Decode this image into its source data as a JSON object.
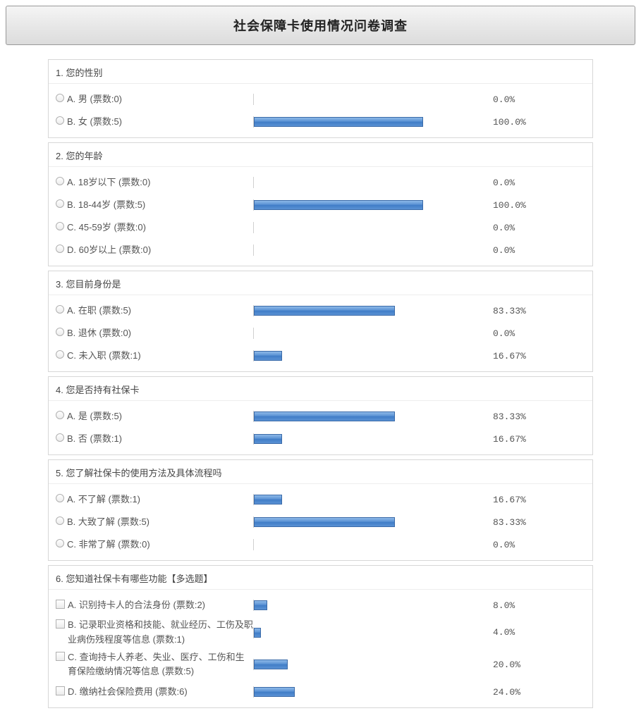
{
  "title": "社会保障卡使用情况问卷调查",
  "chart_data": {
    "type": "bar",
    "questions": [
      {
        "title": "1. 您的性别",
        "kind": "radio",
        "options": [
          {
            "label": "A. 男 (票数:0)",
            "votes": 0,
            "pct": 0.0,
            "pct_label": "0.0%"
          },
          {
            "label": "B. 女 (票数:5)",
            "votes": 5,
            "pct": 100.0,
            "pct_label": "100.0%"
          }
        ]
      },
      {
        "title": "2. 您的年龄",
        "kind": "radio",
        "options": [
          {
            "label": "A. 18岁以下 (票数:0)",
            "votes": 0,
            "pct": 0.0,
            "pct_label": "0.0%"
          },
          {
            "label": "B. 18-44岁 (票数:5)",
            "votes": 5,
            "pct": 100.0,
            "pct_label": "100.0%"
          },
          {
            "label": "C. 45-59岁 (票数:0)",
            "votes": 0,
            "pct": 0.0,
            "pct_label": "0.0%"
          },
          {
            "label": "D. 60岁以上 (票数:0)",
            "votes": 0,
            "pct": 0.0,
            "pct_label": "0.0%"
          }
        ]
      },
      {
        "title": "3. 您目前身份是",
        "kind": "radio",
        "options": [
          {
            "label": "A. 在职 (票数:5)",
            "votes": 5,
            "pct": 83.33,
            "pct_label": "83.33%"
          },
          {
            "label": "B. 退休 (票数:0)",
            "votes": 0,
            "pct": 0.0,
            "pct_label": "0.0%"
          },
          {
            "label": "C. 未入职 (票数:1)",
            "votes": 1,
            "pct": 16.67,
            "pct_label": "16.67%"
          }
        ]
      },
      {
        "title": "4. 您是否持有社保卡",
        "kind": "radio",
        "options": [
          {
            "label": "A. 是 (票数:5)",
            "votes": 5,
            "pct": 83.33,
            "pct_label": "83.33%"
          },
          {
            "label": "B. 否 (票数:1)",
            "votes": 1,
            "pct": 16.67,
            "pct_label": "16.67%"
          }
        ]
      },
      {
        "title": "5. 您了解社保卡的使用方法及具体流程吗",
        "kind": "radio",
        "options": [
          {
            "label": "A. 不了解 (票数:1)",
            "votes": 1,
            "pct": 16.67,
            "pct_label": "16.67%"
          },
          {
            "label": "B. 大致了解 (票数:5)",
            "votes": 5,
            "pct": 83.33,
            "pct_label": "83.33%"
          },
          {
            "label": "C. 非常了解 (票数:0)",
            "votes": 0,
            "pct": 0.0,
            "pct_label": "0.0%"
          }
        ]
      },
      {
        "title": "6. 您知道社保卡有哪些功能【多选题】",
        "kind": "checkbox",
        "options": [
          {
            "label": "A. 识别持卡人的合法身份 (票数:2)",
            "votes": 2,
            "pct": 8.0,
            "pct_label": "8.0%"
          },
          {
            "label": "B. 记录职业资格和技能、就业经历、工伤及职业病伤残程度等信息 (票数:1)",
            "votes": 1,
            "pct": 4.0,
            "pct_label": "4.0%"
          },
          {
            "label": "C. 查询持卡人养老、失业、医疗、工伤和生育保险缴纳情况等信息 (票数:5)",
            "votes": 5,
            "pct": 20.0,
            "pct_label": "20.0%"
          },
          {
            "label": "D. 缴纳社会保险费用 (票数:6)",
            "votes": 6,
            "pct": 24.0,
            "pct_label": "24.0%"
          }
        ]
      }
    ]
  }
}
